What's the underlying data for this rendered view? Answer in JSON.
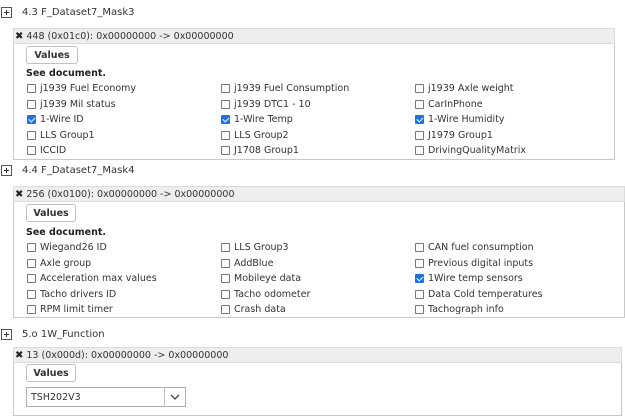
{
  "sections": [
    {
      "title": "4.3 F_Dataset7_Mask3",
      "item": "448 (0x01c0): 0x00000000 -> 0x00000000",
      "tab": "Values",
      "note": "See document.",
      "columns": [
        [
          {
            "label": "j1939 Fuel Economy",
            "checked": false
          },
          {
            "label": "j1939 Mil status",
            "checked": false
          },
          {
            "label": "1-Wire ID",
            "checked": true
          },
          {
            "label": "LLS Group1",
            "checked": false
          },
          {
            "label": "ICCID",
            "checked": false
          }
        ],
        [
          {
            "label": "j1939 Fuel Consumption",
            "checked": false
          },
          {
            "label": "j1939 DTC1 - 10",
            "checked": false
          },
          {
            "label": "1-Wire Temp",
            "checked": true
          },
          {
            "label": "LLS Group2",
            "checked": false
          },
          {
            "label": "J1708 Group1",
            "checked": false
          }
        ],
        [
          {
            "label": "j1939 Axle weight",
            "checked": false
          },
          {
            "label": "CarInPhone",
            "checked": false
          },
          {
            "label": "1-Wire Humidity",
            "checked": true
          },
          {
            "label": "J1979 Group1",
            "checked": false
          },
          {
            "label": "DrivingQualityMatrix",
            "checked": false
          }
        ]
      ]
    },
    {
      "title": "4.4 F_Dataset7_Mask4",
      "item": "256 (0x0100): 0x00000000 -> 0x00000000",
      "tab": "Values",
      "note": "See document.",
      "columns": [
        [
          {
            "label": "Wiegand26 ID",
            "checked": false
          },
          {
            "label": "Axle group",
            "checked": false
          },
          {
            "label": "Acceleration max values",
            "checked": false
          },
          {
            "label": "Tacho drivers ID",
            "checked": false
          },
          {
            "label": "RPM limit timer",
            "checked": false
          }
        ],
        [
          {
            "label": "LLS Group3",
            "checked": false
          },
          {
            "label": "AddBlue",
            "checked": false
          },
          {
            "label": "Mobileye data",
            "checked": false
          },
          {
            "label": "Tacho odometer",
            "checked": false
          },
          {
            "label": "Crash data",
            "checked": false
          }
        ],
        [
          {
            "label": "CAN fuel consumption",
            "checked": false
          },
          {
            "label": "Previous digital inputs",
            "checked": false
          },
          {
            "label": "1Wire temp sensors",
            "checked": true
          },
          {
            "label": "Data Cold temperatures",
            "checked": false
          },
          {
            "label": "Tachograph info",
            "checked": false
          }
        ]
      ]
    },
    {
      "title": "5.o 1W_Function",
      "item": "13 (0x000d): 0x00000000 -> 0x00000000",
      "tab": "Values",
      "select_value": "TSH202V3"
    }
  ]
}
